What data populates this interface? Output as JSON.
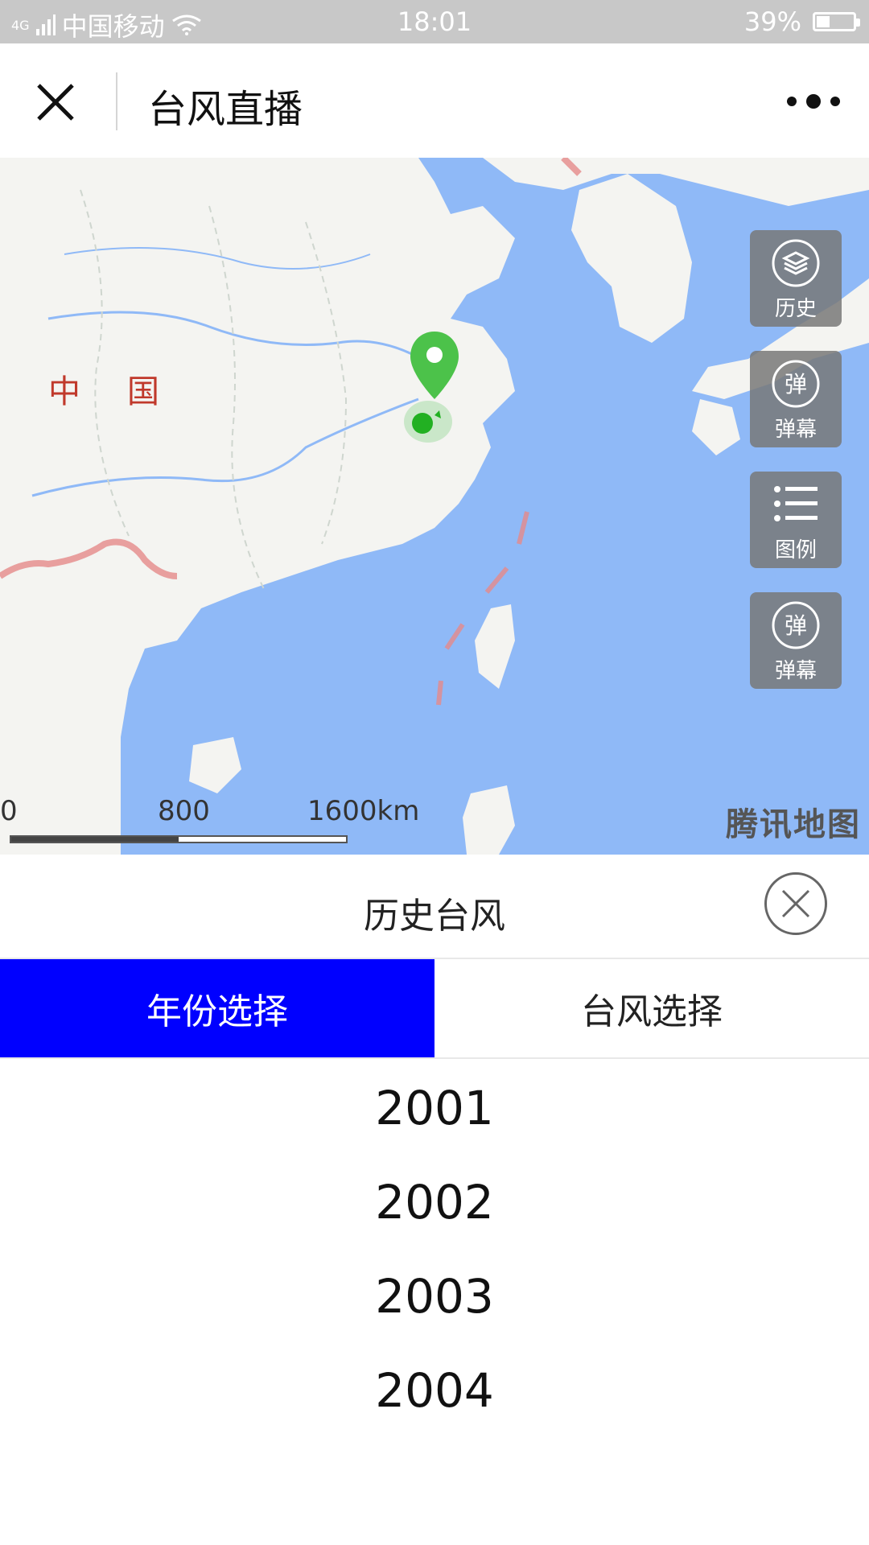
{
  "status_bar": {
    "network": "4G",
    "carrier": "中国移动",
    "time": "18:01",
    "battery": "39%",
    "battery_level": 0.39
  },
  "navbar": {
    "title": "台风直播"
  },
  "map": {
    "country_label": "中国",
    "buttons": [
      {
        "label": "历史",
        "icon": "layers-icon"
      },
      {
        "label": "弹幕",
        "icon": "danmaku-icon"
      },
      {
        "label": "图例",
        "icon": "list-icon"
      },
      {
        "label": "弹幕",
        "icon": "danmaku-icon"
      }
    ],
    "scale": {
      "labels": [
        "0",
        "800",
        "1600km"
      ]
    },
    "watermark": "腾讯地图",
    "colors": {
      "sea": "#8fb9f7",
      "land": "#f4f4f1",
      "marker": "#4cc24a",
      "border": "#e58a8a"
    }
  },
  "panel": {
    "title": "历史台风",
    "tabs": [
      {
        "label": "年份选择",
        "active": true
      },
      {
        "label": "台风选择",
        "active": false
      }
    ],
    "years": [
      "2001",
      "2002",
      "2003",
      "2004"
    ],
    "colors": {
      "active_tab": "#0000ff"
    }
  }
}
